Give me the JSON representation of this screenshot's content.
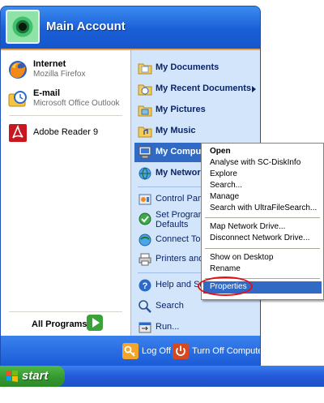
{
  "header": {
    "account_name": "Main Account"
  },
  "pinned": [
    {
      "title": "Internet",
      "subtitle": "Mozilla Firefox",
      "icon": "firefox-icon"
    },
    {
      "title": "E-mail",
      "subtitle": "Microsoft Office Outlook",
      "icon": "outlook-icon"
    }
  ],
  "recent": [
    {
      "label": "Adobe Reader 9",
      "icon": "adobe-reader-icon"
    }
  ],
  "all_programs": {
    "label": "All Programs"
  },
  "places": [
    {
      "label": "My Documents",
      "icon": "folder-documents-icon"
    },
    {
      "label": "My Recent Documents",
      "icon": "recent-documents-icon",
      "submenu": true
    },
    {
      "label": "My Pictures",
      "icon": "folder-pictures-icon"
    },
    {
      "label": "My Music",
      "icon": "folder-music-icon"
    },
    {
      "label": "My Computer",
      "icon": "computer-icon",
      "highlighted": true
    },
    {
      "label": "My Network Places",
      "icon": "network-icon"
    }
  ],
  "tools": [
    {
      "label": "Control Panel",
      "icon": "control-panel-icon"
    },
    {
      "label": "Set Program Access and Defaults",
      "line1": "Set Program",
      "line2": "Defaults",
      "icon": "program-access-icon"
    },
    {
      "label": "Connect To",
      "icon": "connect-icon"
    },
    {
      "label": "Printers and Faxes",
      "icon": "printer-icon"
    }
  ],
  "help": [
    {
      "label": "Help and Support",
      "icon": "help-icon"
    },
    {
      "label": "Search",
      "icon": "search-icon"
    },
    {
      "label": "Run...",
      "icon": "run-icon"
    }
  ],
  "footer": {
    "logoff_label": "Log Off",
    "turnoff_label": "Turn Off Computer"
  },
  "taskbar": {
    "start_label": "start"
  },
  "context_menu": {
    "group1": [
      "Open",
      "Analyse with SC-DiskInfo",
      "Explore",
      "Search...",
      "Manage",
      "Search with UltraFileSearch..."
    ],
    "group2": [
      "Map Network Drive...",
      "Disconnect Network Drive..."
    ],
    "group3": [
      "Show on Desktop",
      "Rename"
    ],
    "group4": [
      "Properties"
    ],
    "default_item": "Open",
    "highlighted_item": "Properties"
  },
  "colors": {
    "accent_blue": "#1f5fe0",
    "highlight": "#316ac5",
    "annotation_red": "#e0101a",
    "start_green": "#3aa238"
  }
}
